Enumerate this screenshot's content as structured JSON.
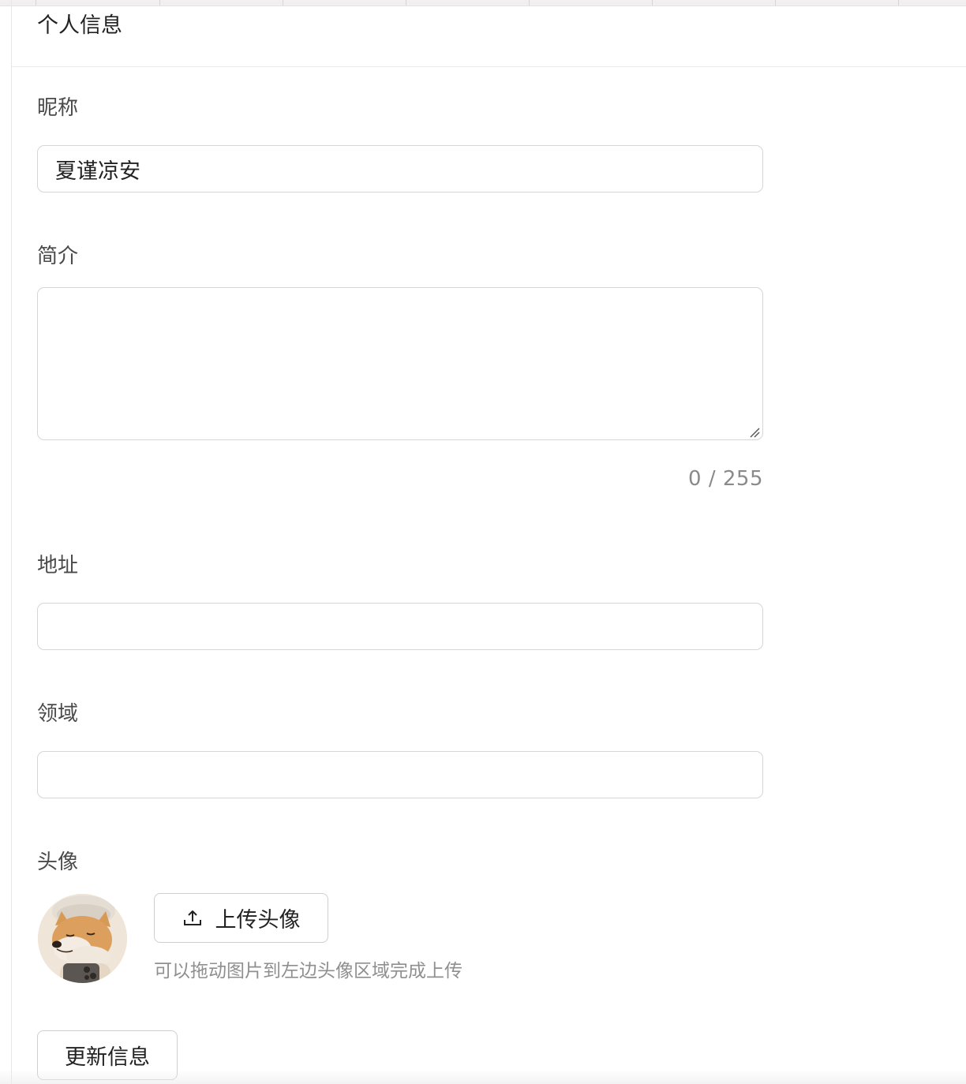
{
  "page": {
    "title": "个人信息"
  },
  "form": {
    "nickname": {
      "label": "昵称",
      "value": "夏谨凉安"
    },
    "bio": {
      "label": "简介",
      "value": "",
      "counter": "0 / 255"
    },
    "address": {
      "label": "地址",
      "value": ""
    },
    "field": {
      "label": "领域",
      "value": ""
    },
    "avatar": {
      "label": "头像",
      "upload_label": "上传头像",
      "upload_icon": "upload-icon",
      "hint": "可以拖动图片到左边头像区域完成上传",
      "image": "shiba-dog-with-towel-photo"
    },
    "submit_label": "更新信息"
  },
  "colors": {
    "border": "#d6d6d6",
    "label": "#4a4a4a",
    "muted": "#8f8f8f",
    "top_strip": "#f2eff1"
  }
}
